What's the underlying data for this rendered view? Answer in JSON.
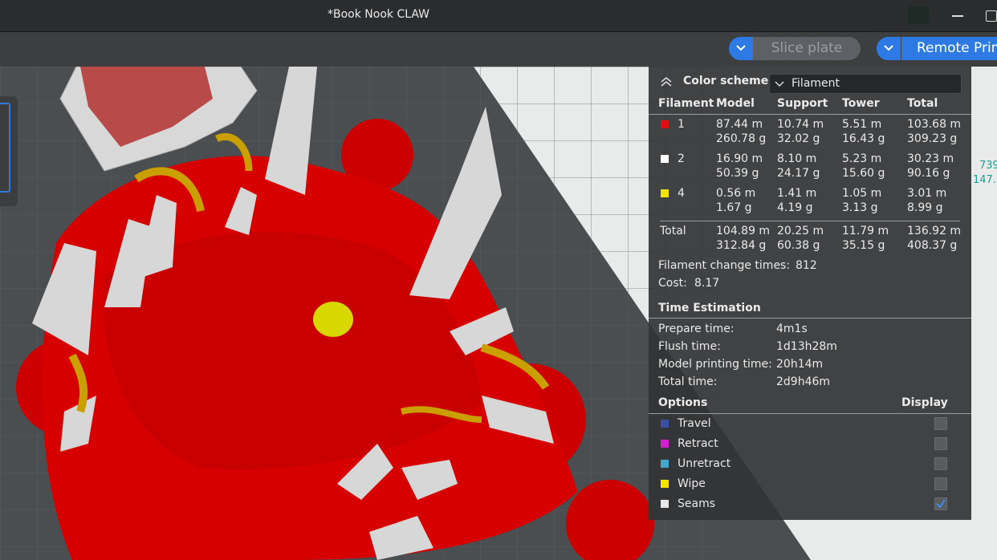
{
  "window": {
    "title": "*Book Nook CLAW"
  },
  "toolbar": {
    "slice_label": "Slice plate",
    "remote_label": "Remote Print"
  },
  "ruler": {
    "x_value": "739",
    "y_value": "147."
  },
  "panel": {
    "color_scheme_label": "Color scheme",
    "color_scheme_value": "Filament",
    "columns": [
      "Filament",
      "Model",
      "Support",
      "Tower",
      "Total"
    ],
    "rows": [
      {
        "id": "1",
        "color": "#e01010",
        "model_len": "87.44 m",
        "model_wt": "260.78 g",
        "support_len": "10.74 m",
        "support_wt": "32.02 g",
        "tower_len": "5.51 m",
        "tower_wt": "16.43 g",
        "total_len": "103.68 m",
        "total_wt": "309.23 g"
      },
      {
        "id": "2",
        "color": "#ffffff",
        "model_len": "16.90 m",
        "model_wt": "50.39 g",
        "support_len": "8.10 m",
        "support_wt": "24.17 g",
        "tower_len": "5.23 m",
        "tower_wt": "15.60 g",
        "total_len": "30.23 m",
        "total_wt": "90.16 g"
      },
      {
        "id": "4",
        "color": "#f5e400",
        "model_len": "0.56 m",
        "model_wt": "1.67 g",
        "support_len": "1.41 m",
        "support_wt": "4.19 g",
        "tower_len": "1.05 m",
        "tower_wt": "3.13 g",
        "total_len": "3.01 m",
        "total_wt": "8.99 g"
      }
    ],
    "total": {
      "label": "Total",
      "model_len": "104.89 m",
      "model_wt": "312.84 g",
      "support_len": "20.25 m",
      "support_wt": "60.38 g",
      "tower_len": "11.79 m",
      "tower_wt": "35.15 g",
      "total_len": "136.92 m",
      "total_wt": "408.37 g"
    },
    "filament_change_label": "Filament change times:",
    "filament_change_value": "812",
    "cost_label": "Cost:",
    "cost_value": "8.17",
    "time_estimation_label": "Time Estimation",
    "times": [
      {
        "label": "Prepare time:",
        "value": "4m1s"
      },
      {
        "label": "Flush time:",
        "value": "1d13h28m"
      },
      {
        "label": "Model printing time:",
        "value": "20h14m"
      },
      {
        "label": "Total time:",
        "value": "2d9h46m"
      }
    ],
    "options_label": "Options",
    "display_label": "Display",
    "options": [
      {
        "label": "Travel",
        "color": "#3a4fa6",
        "checked": false
      },
      {
        "label": "Retract",
        "color": "#d21fd2",
        "checked": false
      },
      {
        "label": "Unretract",
        "color": "#3fa8cc",
        "checked": false
      },
      {
        "label": "Wipe",
        "color": "#f5e400",
        "checked": false
      },
      {
        "label": "Seams",
        "color": "#e8e8e8",
        "checked": true
      }
    ]
  }
}
